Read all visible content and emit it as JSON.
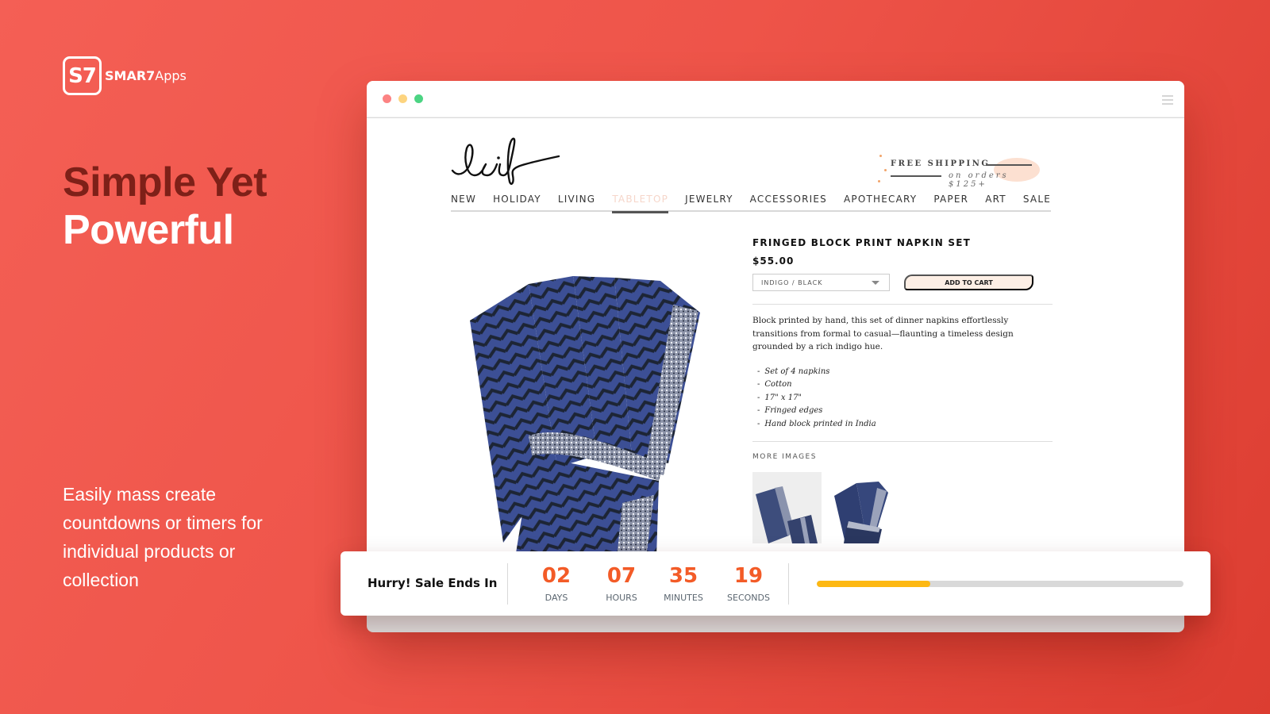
{
  "brand": {
    "mark": "S7",
    "name_bold": "SMAR7",
    "name_rest": "Apps"
  },
  "headline": {
    "line1": "Simple Yet",
    "line2": "Powerful"
  },
  "subtext": "Easily mass create countdowns or timers for individual products or collection",
  "store": {
    "logo_text": "leif",
    "shipping": {
      "line1": "FREE SHIPPING",
      "line2": "on orders $125+"
    },
    "nav": [
      {
        "label": "NEW",
        "active": false
      },
      {
        "label": "HOLIDAY",
        "active": false
      },
      {
        "label": "LIVING",
        "active": false
      },
      {
        "label": "TABLETOP",
        "active": true
      },
      {
        "label": "JEWELRY",
        "active": false
      },
      {
        "label": "ACCESSORIES",
        "active": false
      },
      {
        "label": "APOTHECARY",
        "active": false
      },
      {
        "label": "PAPER",
        "active": false
      },
      {
        "label": "ART",
        "active": false
      },
      {
        "label": "SALE",
        "active": false
      }
    ],
    "product": {
      "title": "FRINGED BLOCK PRINT NAPKIN SET",
      "price": "$55.00",
      "variant": "INDIGO / BLACK",
      "add_to_cart": "ADD TO CART",
      "description": "Block printed by hand, this set of dinner napkins effortlessly transitions from formal to casual—flaunting a timeless design grounded by a rich indigo hue.",
      "features": [
        "Set of 4 napkins",
        "Cotton",
        "17\" x 17\"",
        "Fringed edges",
        "Hand block printed in India"
      ],
      "more_images_label": "MORE IMAGES"
    }
  },
  "countdown": {
    "label": "Hurry! Sale Ends In",
    "units": [
      {
        "value": "02",
        "label": "DAYS"
      },
      {
        "value": "07",
        "label": "HOURS"
      },
      {
        "value": "35",
        "label": "MINUTES"
      },
      {
        "value": "19",
        "label": "SECONDS"
      }
    ],
    "progress_percent": 31
  },
  "colors": {
    "accent_number": "#f35b27",
    "progress_fill": "#fdb813",
    "background": "#ee5449",
    "headline_dark": "#7e2018"
  }
}
